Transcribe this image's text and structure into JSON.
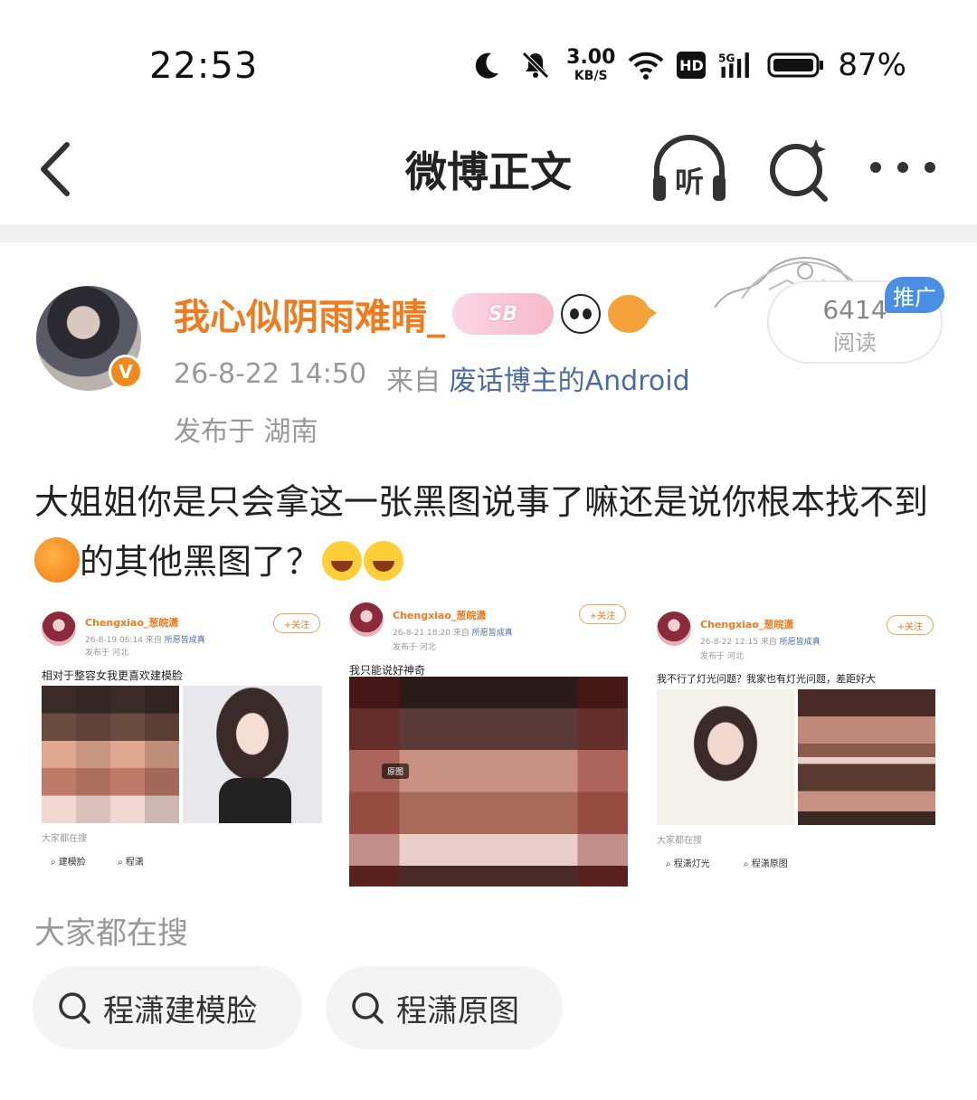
{
  "status_bar": {
    "time": "22:53",
    "net_speed_value": "3.00",
    "net_speed_unit": "KB/S",
    "hd_label": "HD",
    "signal_label": "5G",
    "battery_percent": "87%"
  },
  "nav": {
    "title": "微博正文",
    "listen_icon": "headphones-icon",
    "listen_label": "听"
  },
  "post": {
    "author": {
      "username": "我心似阴雨难晴_",
      "badge_text": "SB",
      "verified_symbol": "V"
    },
    "timestamp": "26-8-22 14:50",
    "source_prefix": "来自",
    "source": "废话博主的Android",
    "location": "发布于 湖南",
    "read_count": "6414",
    "read_label": "阅读",
    "promo_tag": "推广",
    "text_part1": "大姐姐你是只会拿这一张黑图说事了嘛还是说你根本找不到",
    "text_part2": "的其他黑图了？"
  },
  "embedded_shots": [
    {
      "name": "Chengxiao_葱皖潇",
      "time": "26-8-19 06:14",
      "source_prefix": "来自",
      "source": "所愿皆成真",
      "location": "发布于 河北",
      "follow": "+关注",
      "text": "相对于整容女我更喜欢建模脸",
      "search_label": "大家都在搜",
      "chips": [
        "建模脸",
        "程潇"
      ]
    },
    {
      "name": "Chengxiao_葱皖潇",
      "time": "26-8-21 18:20",
      "source_prefix": "来自",
      "source": "所愿皆成真",
      "location": "发布于 河北",
      "follow": "+关注",
      "text": "我只能说好神奇",
      "tag": "原图"
    },
    {
      "name": "Chengxiao_葱皖潇",
      "time": "26-8-22 12:15",
      "source_prefix": "来自",
      "source": "所愿皆成真",
      "location": "发布于 河北",
      "follow": "+关注",
      "text": "我不行了灯光问题？我家也有灯光问题，差距好大",
      "search_label": "大家都在搜",
      "chips": [
        "程潇灯光",
        "程潇原图"
      ]
    }
  ],
  "hot_search": {
    "label": "大家都在搜",
    "items": [
      "程潇建模脸",
      "程潇原图"
    ]
  },
  "colors": {
    "username": "#f07a1c",
    "source_link": "#4a6aa8",
    "promo": "#4a90e2"
  }
}
